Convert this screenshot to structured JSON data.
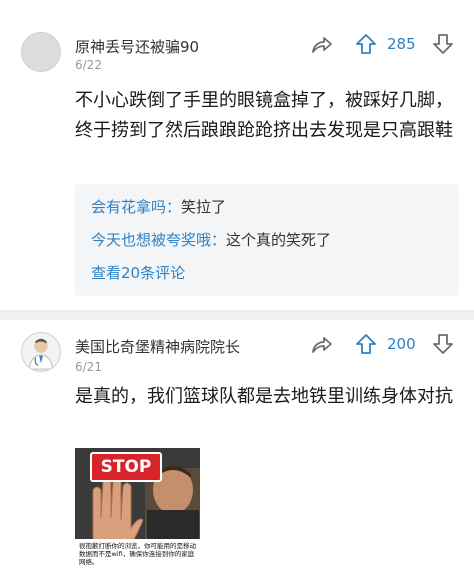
{
  "comment1": {
    "username": "原神丢号还被骗90",
    "date": "6/22",
    "likes": "285",
    "text": "不小心跌倒了手里的眼镜盒掉了，被踩好几脚，终于捞到了然后踉踉跄跄挤出去发现是只高跟鞋",
    "replies": [
      {
        "name": "会有花拿吗：",
        "text": "笑拉了"
      },
      {
        "name": "今天也想被夸奖哦：",
        "text": "这个真的笑死了"
      }
    ],
    "view_more": "查看20条评论"
  },
  "comment2": {
    "username": "美国比奇堡精神病院院长",
    "date": "6/21",
    "likes": "200",
    "text": "是真的，我们篮球队都是去地铁里训练身体对抗",
    "meme": {
      "stop_text": "STOP",
      "caption": "很抱歉打断你的浏览，你可能用的是移动数据而不是wifi，确保你连接到你的家庭网络。"
    }
  },
  "colors": {
    "accent": "#2f82c4",
    "icon": "#6d6d6d",
    "reply_bg": "#f4f5f7"
  },
  "icons": [
    "share-icon",
    "upvote-icon",
    "downvote-icon"
  ]
}
